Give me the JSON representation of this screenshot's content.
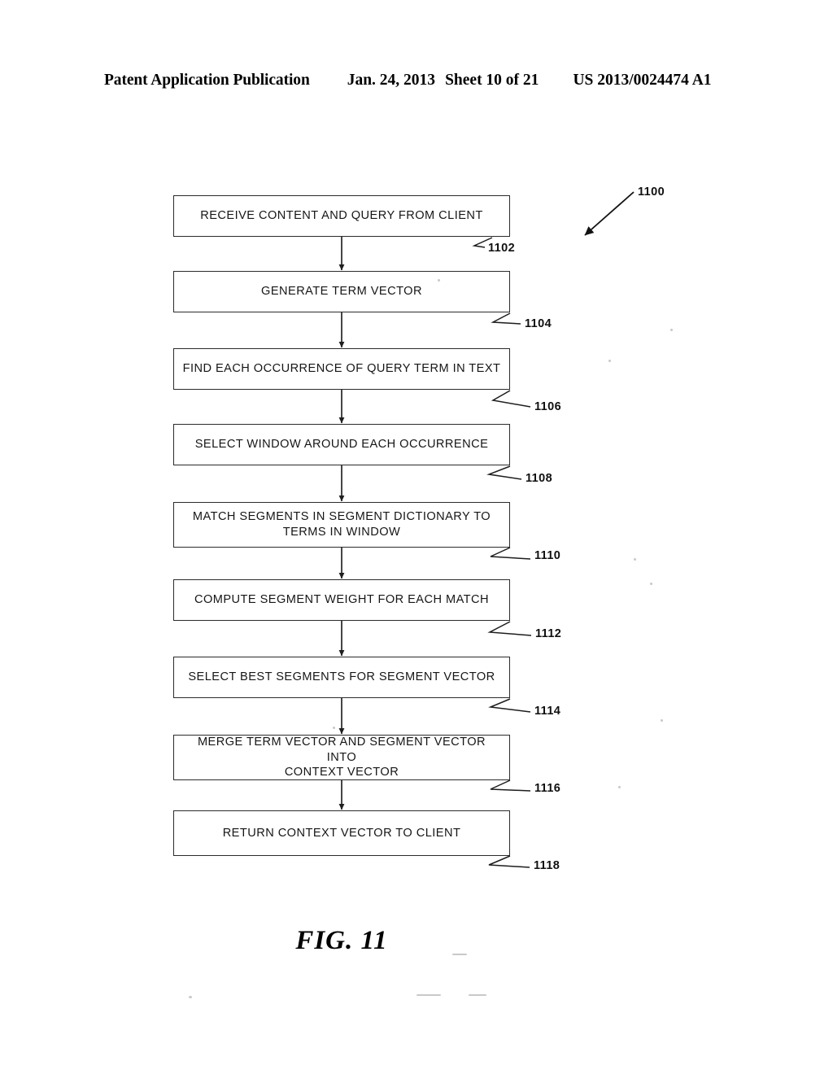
{
  "header": {
    "publication": "Patent Application Publication",
    "date": "Jan. 24, 2013",
    "sheet": "Sheet 10 of 21",
    "patent_number": "US 2013/0024474 A1"
  },
  "figure": {
    "caption": "FIG. 11",
    "diagram_ref": "1100"
  },
  "flowchart": {
    "steps": [
      {
        "ref": "1102",
        "label": "RECEIVE CONTENT AND QUERY FROM CLIENT"
      },
      {
        "ref": "1104",
        "label": "GENERATE TERM VECTOR"
      },
      {
        "ref": "1106",
        "label": "FIND EACH OCCURRENCE OF QUERY TERM IN TEXT"
      },
      {
        "ref": "1108",
        "label": "SELECT WINDOW AROUND EACH OCCURRENCE"
      },
      {
        "ref": "1110",
        "label": "MATCH SEGMENTS IN SEGMENT DICTIONARY TO\nTERMS IN WINDOW"
      },
      {
        "ref": "1112",
        "label": "COMPUTE SEGMENT WEIGHT FOR EACH MATCH"
      },
      {
        "ref": "1114",
        "label": "SELECT BEST SEGMENTS FOR SEGMENT VECTOR"
      },
      {
        "ref": "1116",
        "label": "MERGE TERM VECTOR AND SEGMENT VECTOR INTO\nCONTEXT VECTOR"
      },
      {
        "ref": "1118",
        "label": "RETURN CONTEXT VECTOR TO CLIENT"
      }
    ]
  }
}
